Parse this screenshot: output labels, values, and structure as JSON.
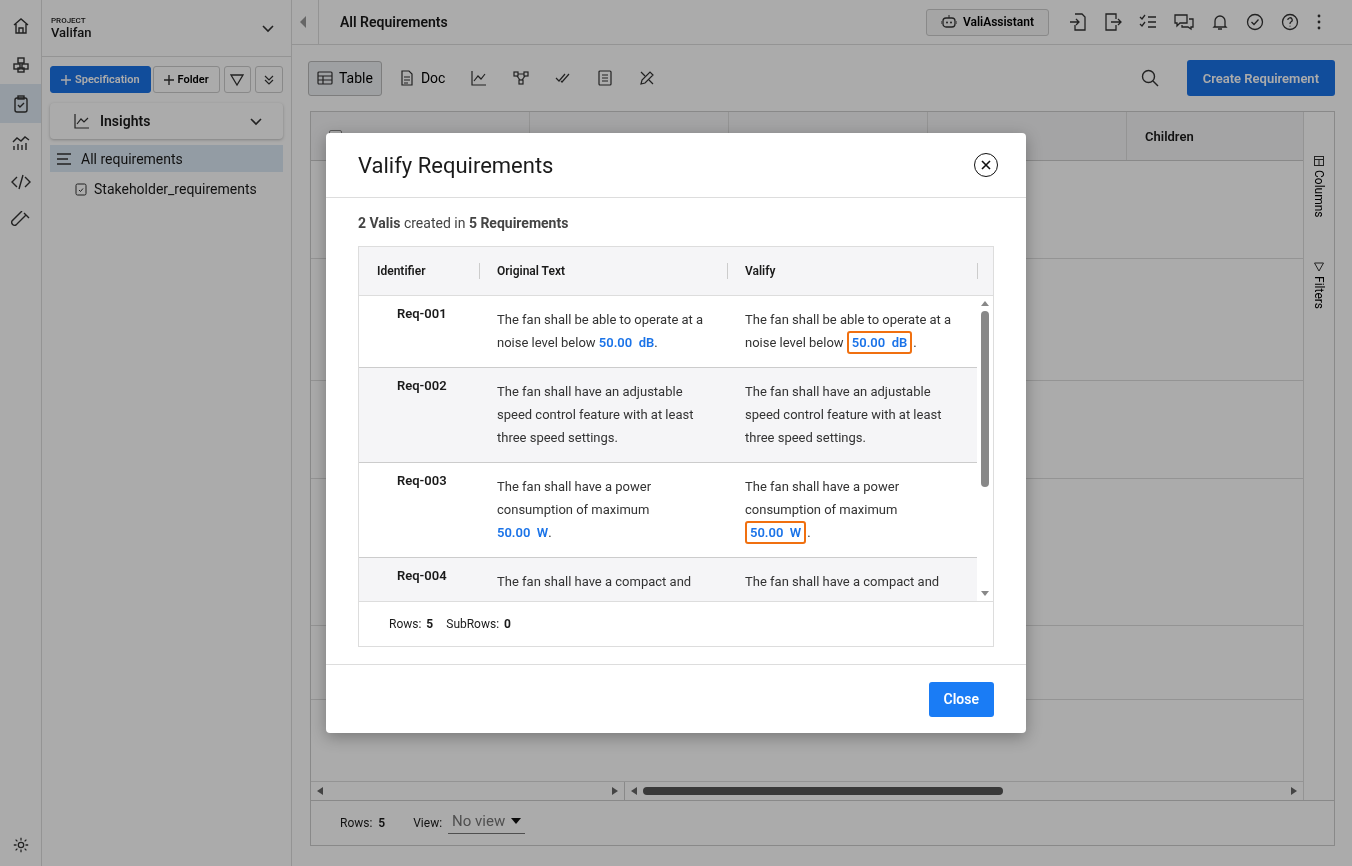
{
  "rail": {
    "items": [
      {
        "kind": "home",
        "selected": false
      },
      {
        "kind": "boxes",
        "selected": false
      },
      {
        "kind": "clipboard",
        "selected": true
      },
      {
        "kind": "chart",
        "selected": false
      },
      {
        "kind": "code",
        "selected": false
      },
      {
        "kind": "tube",
        "selected": false
      }
    ]
  },
  "sidebar": {
    "project_label": "PROJECT",
    "project_name": "Valifan",
    "buttons": [
      {
        "label": "Specification",
        "kind": "primary"
      },
      {
        "label": "Folder",
        "kind": "secondary"
      }
    ],
    "insights": "Insights",
    "tree": [
      {
        "label": "All requirements",
        "selected": true,
        "kind": "list",
        "children": [
          {
            "label": "Stakeholder_requirements",
            "selected": false,
            "kind": "spec"
          }
        ]
      }
    ]
  },
  "header": {
    "title": "All Requirements",
    "assistant": "ValiAssistant"
  },
  "toolbar": {
    "views": [
      {
        "label": "Table",
        "kind": "table",
        "selected": true
      },
      {
        "label": "Doc",
        "kind": "doc",
        "selected": false
      },
      {
        "kind": "chart",
        "selected": false
      },
      {
        "kind": "graph",
        "selected": false
      },
      {
        "kind": "checks",
        "selected": false
      },
      {
        "kind": "list",
        "selected": false
      },
      {
        "kind": "tools",
        "selected": false
      }
    ],
    "create_button": "Create Requirement"
  },
  "background_table": {
    "select_all_checked": false,
    "visible_heading": "Children",
    "side_tabs": [
      "Columns",
      "Filters"
    ]
  },
  "status_bar": {
    "rows_label": "Rows:",
    "rows": "5",
    "view_label": "View:",
    "view": "No view"
  },
  "dialog": {
    "title": "Valify Requirements",
    "summary": "**2 Valis** created in **5 Requirements**",
    "columns": [
      "Identifier",
      "Original Text",
      "Valify"
    ],
    "rows": [
      {
        "id": "Req-001",
        "original": [
          {
            "kind": "plain",
            "text": "The fan shall be able to operate at a noise level below "
          },
          {
            "kind": "quantity",
            "text": "50.00  dB"
          },
          {
            "kind": "plain",
            "text": "."
          }
        ],
        "valify": [
          {
            "kind": "plain",
            "text": "The fan shall be able to operate at a noise level below "
          },
          {
            "kind": "vali",
            "text": "50.00  dB"
          },
          {
            "kind": "plain",
            "text": "."
          }
        ]
      },
      {
        "id": "Req-002",
        "original": [
          {
            "kind": "plain",
            "text": "The fan shall have an adjustable speed control feature with at least three speed settings."
          }
        ],
        "valify": [
          {
            "kind": "plain",
            "text": "The fan shall have an adjustable speed control feature with at least three speed settings."
          }
        ]
      },
      {
        "id": "Req-003",
        "original": [
          {
            "kind": "plain",
            "text": "The fan shall have a power consumption of maximum "
          },
          {
            "kind": "quantity",
            "text": "50.00  W"
          },
          {
            "kind": "plain",
            "text": "."
          }
        ],
        "valify": [
          {
            "kind": "plain",
            "text": "The fan shall have a power consumption of maximum "
          },
          {
            "kind": "vali",
            "text": "50.00  W"
          },
          {
            "kind": "plain",
            "text": "."
          }
        ]
      },
      {
        "id": "Req-004",
        "original": [
          {
            "kind": "plain",
            "text": "The fan shall have a compact and"
          }
        ],
        "valify": [
          {
            "kind": "plain",
            "text": "The fan shall have a compact and"
          }
        ]
      }
    ],
    "footer": {
      "rows_label": "Rows:",
      "rows": "5",
      "subrows_label": "SubRows:",
      "subrows": "0"
    },
    "close_button": "Close"
  }
}
